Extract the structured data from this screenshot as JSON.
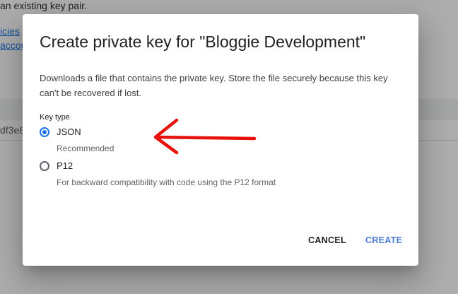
{
  "background": {
    "line1": "an existing key pair.",
    "link1": "icies",
    "link2": "accou",
    "key_id_fragment": "df3e8"
  },
  "dialog": {
    "title": "Create private key for \"Bloggie Development\"",
    "description": "Downloads a file that contains the private key. Store the file securely because this key can't be recovered if lost.",
    "key_type_label": "Key type",
    "options": [
      {
        "label": "JSON",
        "hint": "Recommended",
        "selected": true
      },
      {
        "label": "P12",
        "hint": "For backward compatibility with code using the P12 format",
        "selected": false
      }
    ],
    "cancel_label": "CANCEL",
    "create_label": "CREATE"
  },
  "colors": {
    "accent": "#1a73e8",
    "annotation": "#e8120c",
    "create_text": "#4c7bd9"
  },
  "icons": {
    "external_link": "external-link-icon",
    "annotation": "red-arrow-annotation"
  }
}
